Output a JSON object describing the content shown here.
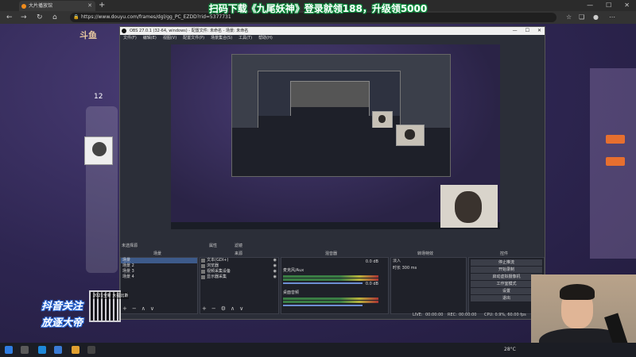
{
  "browser": {
    "tab_title": "大片播放馆",
    "url": "https://www.douyu.com/frames/dgl/gg_PC_EZDD?rid=5377731",
    "minimize_icon": "minimize-icon",
    "maximize_icon": "maximize-icon",
    "close_icon": "close-icon"
  },
  "page": {
    "site_logo": "斗鱼",
    "side_count": "12"
  },
  "overlay": {
    "banner": "扫码下载《九尾妖神》登录就领188，升级领5000",
    "follow_line1": "抖音关注",
    "follow_line2": "放逐大帝",
    "qr_text": "2021全新 大福比斯"
  },
  "obs": {
    "title": "OBS 27.0.1 (32-64, windows) - 配置文件: 未命名 - 场景: 未命名",
    "menu": [
      "文件(F)",
      "编辑(E)",
      "视图(V)",
      "配置文件(P)",
      "场景集合(S)",
      "工具(T)",
      "帮助(H)"
    ],
    "dock_titles": {
      "scenes": "场景",
      "sources": "来源",
      "mixer": "混音器",
      "transitions": "转场特效",
      "controls": "控件",
      "filters_tab": "属性",
      "extra_tab": "滤镜",
      "no_source": "未选择源"
    },
    "scenes": [
      "场景",
      "场景 2",
      "场景 3",
      "场景 4"
    ],
    "sources": [
      {
        "label": "文本(GDI+)",
        "icon": "text-icon"
      },
      {
        "label": "浏览器",
        "icon": "browser-icon"
      },
      {
        "label": "视频采集设备",
        "icon": "camera-icon"
      },
      {
        "label": "显示器采集",
        "icon": "monitor-icon"
      }
    ],
    "mixer": [
      {
        "name": "麦克风/Aux",
        "db": "0.0 dB"
      },
      {
        "name": "桌面音频",
        "db": "0.0 dB"
      }
    ],
    "transition": {
      "type": "淡入",
      "duration_label": "时长",
      "duration": "300 ms"
    },
    "controls": [
      "停止推流",
      "开始录制",
      "启动虚拟摄像机",
      "工作室模式",
      "设置",
      "退出"
    ],
    "status": {
      "live_label": "LIVE:",
      "live_time": "00:00:00",
      "rec_label": "REC:",
      "rec_time": "00:00:00",
      "cpu": "CPU: 0.9%, 60.00 fps"
    }
  },
  "taskbar": {
    "weather": "28°C"
  }
}
